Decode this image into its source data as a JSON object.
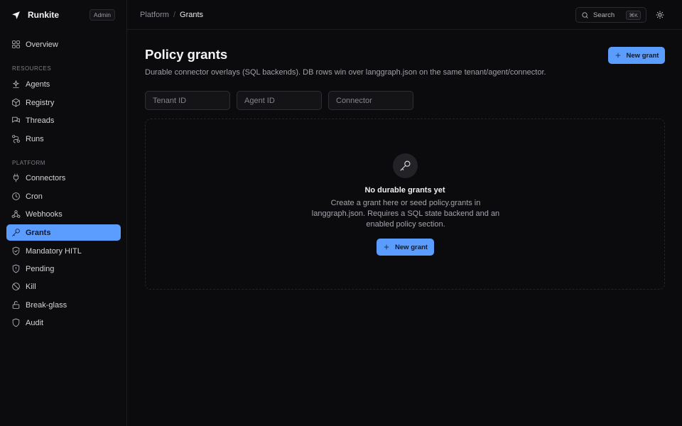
{
  "app": {
    "name": "Runkite",
    "role": "Admin"
  },
  "sidebar": {
    "overview": {
      "label": "Overview",
      "icon": "grid-icon"
    },
    "resources_label": "RESOURCES",
    "resources": [
      {
        "label": "Agents",
        "icon": "agent-icon"
      },
      {
        "label": "Registry",
        "icon": "cube-icon"
      },
      {
        "label": "Threads",
        "icon": "threads-icon"
      },
      {
        "label": "Runs",
        "icon": "runs-icon"
      }
    ],
    "platform_label": "PLATFORM",
    "platform": [
      {
        "label": "Connectors",
        "icon": "plug-icon"
      },
      {
        "label": "Cron",
        "icon": "clock-icon"
      },
      {
        "label": "Webhooks",
        "icon": "webhook-icon"
      },
      {
        "label": "Grants",
        "icon": "key-icon",
        "active": true
      },
      {
        "label": "Mandatory HITL",
        "icon": "shield-check-icon"
      },
      {
        "label": "Pending",
        "icon": "shield-alert-icon"
      },
      {
        "label": "Kill",
        "icon": "ban-icon"
      },
      {
        "label": "Break-glass",
        "icon": "lock-open-icon"
      },
      {
        "label": "Audit",
        "icon": "shield-icon"
      }
    ]
  },
  "topbar": {
    "breadcrumb": [
      "Platform",
      "Grants"
    ],
    "breadcrumb_sep": "/",
    "search_label": "Search",
    "search_shortcut": "⌘K"
  },
  "page": {
    "title": "Policy grants",
    "description": "Durable connector overlays (SQL backends). DB rows win over langgraph.json on the same tenant/agent/connector.",
    "new_grant_label": "New grant"
  },
  "filters": {
    "tenant_placeholder": "Tenant ID",
    "agent_placeholder": "Agent ID",
    "connector_placeholder": "Connector"
  },
  "empty_state": {
    "title": "No durable grants yet",
    "text": "Create a grant here or seed policy.grants in langgraph.json. Requires a SQL state backend and an enabled policy section.",
    "button_label": "New grant"
  },
  "colors": {
    "accent": "#5b9cff",
    "background": "#0b0b0d"
  }
}
